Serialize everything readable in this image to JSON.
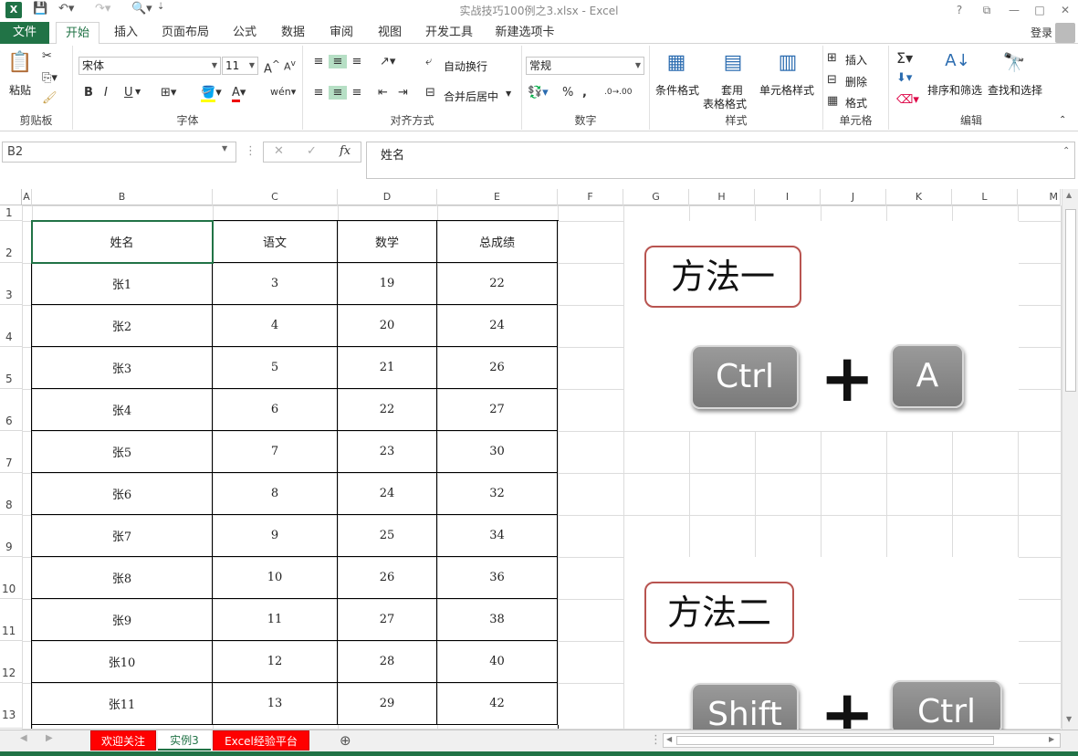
{
  "window": {
    "title": "实战技巧100例之3.xlsx - Excel",
    "controls": [
      "?",
      "⧉",
      "—",
      "□",
      "✕"
    ]
  },
  "ribbon_tabs": [
    "文件",
    "开始",
    "插入",
    "页面布局",
    "公式",
    "数据",
    "审阅",
    "视图",
    "开发工具",
    "新建选项卡"
  ],
  "login": "登录",
  "clipboard": {
    "label": "剪贴板",
    "paste": "粘贴"
  },
  "font": {
    "label": "字体",
    "name": "宋体",
    "size": "11",
    "bold": "B",
    "italic": "I",
    "underline": "U"
  },
  "align": {
    "label": "对齐方式",
    "wrap": "自动换行",
    "merge": "合并后居中"
  },
  "number": {
    "label": "数字",
    "format": "常规",
    "percent": "%",
    "comma": ","
  },
  "styles": {
    "label": "样式",
    "cond": "条件格式",
    "table1": "套用",
    "table2": "表格格式",
    "cell": "单元格样式"
  },
  "cells": {
    "label": "单元格",
    "insert": "插入",
    "delete": "删除",
    "format": "格式"
  },
  "editing": {
    "label": "编辑",
    "sort": "排序和筛选",
    "find": "查找和选择"
  },
  "formula_bar": {
    "name_box": "B2",
    "content": "姓名",
    "fx": "fx"
  },
  "columns": [
    "A",
    "B",
    "C",
    "D",
    "E",
    "F",
    "G",
    "H",
    "I",
    "J",
    "K",
    "L",
    "M"
  ],
  "rows": [
    "1",
    "2",
    "3",
    "4",
    "5",
    "6",
    "7",
    "8",
    "9",
    "10",
    "11",
    "12",
    "13"
  ],
  "table": {
    "headers": [
      "姓名",
      "语文",
      "数学",
      "总成绩"
    ],
    "rows": [
      [
        "张1",
        "3",
        "19",
        "22"
      ],
      [
        "张2",
        "4",
        "20",
        "24"
      ],
      [
        "张3",
        "5",
        "21",
        "26"
      ],
      [
        "张4",
        "6",
        "22",
        "27"
      ],
      [
        "张5",
        "7",
        "23",
        "30"
      ],
      [
        "张6",
        "8",
        "24",
        "32"
      ],
      [
        "张7",
        "9",
        "25",
        "34"
      ],
      [
        "张8",
        "10",
        "26",
        "36"
      ],
      [
        "张9",
        "11",
        "27",
        "38"
      ],
      [
        "张10",
        "12",
        "28",
        "40"
      ],
      [
        "张11",
        "13",
        "29",
        "42"
      ]
    ]
  },
  "method1": {
    "title": "方法一",
    "key1": "Ctrl",
    "plus": "+",
    "key2": "A"
  },
  "method2": {
    "title": "方法二",
    "key1": "Shift",
    "plus": "+",
    "key2": "Ctrl"
  },
  "sheets": [
    {
      "name": "欢迎关注",
      "color": "#ff0000",
      "active": false
    },
    {
      "name": "实例3",
      "color": "#ffffff",
      "active": true
    },
    {
      "name": "Excel经验平台",
      "color": "#ff0000",
      "active": false
    }
  ],
  "add_sheet": "⊕"
}
